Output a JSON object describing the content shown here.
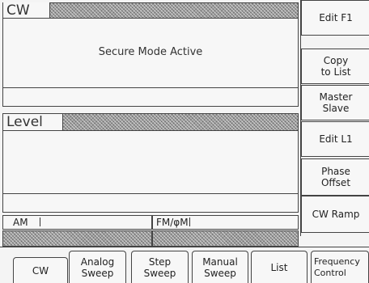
{
  "cw_section": {
    "label": "CW",
    "message": "Secure Mode Active"
  },
  "level_section": {
    "label": "Level"
  },
  "status": {
    "am_label": "AM",
    "fm_label": "FM/φM"
  },
  "softkeys": [
    {
      "line1": "Edit F1",
      "line2": ""
    },
    {
      "line1": "Copy",
      "line2": "to List"
    },
    {
      "line1": "Master",
      "line2": "Slave"
    },
    {
      "line1": "Edit L1",
      "line2": ""
    },
    {
      "line1": "Phase",
      "line2": "Offset"
    },
    {
      "line1": "CW Ramp",
      "line2": ""
    }
  ],
  "tabs": [
    {
      "line1": "CW",
      "line2": ""
    },
    {
      "line1": "Analog",
      "line2": "Sweep"
    },
    {
      "line1": "Step",
      "line2": "Sweep"
    },
    {
      "line1": "Manual",
      "line2": "Sweep"
    },
    {
      "line1": "List",
      "line2": ""
    },
    {
      "line1": "Frequency",
      "line2": "Control"
    }
  ]
}
